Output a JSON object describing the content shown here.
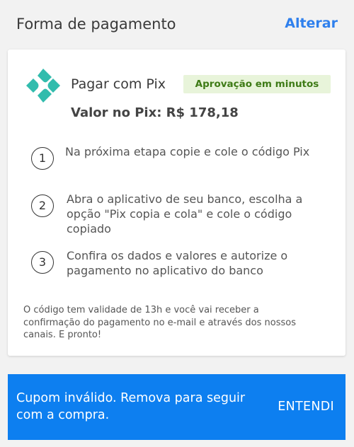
{
  "header": {
    "title": "Forma de pagamento",
    "action_label": "Alterar"
  },
  "payment": {
    "icon": "pix-logo-icon",
    "method_label": "Pagar com Pix",
    "badge": "Aprovação em minutos",
    "price": "Valor no Pix: R$ 178,18",
    "steps": [
      {
        "number": "1",
        "text": "Na próxima etapa copie e cole o código Pix"
      },
      {
        "number": "2",
        "text": "Abra o aplicativo de seu banco, escolha a opção \"Pix copia e cola\" e cole o código copiado"
      },
      {
        "number": "3",
        "text": "Confira os dados e valores e autorize o pagamento no aplicativo do banco"
      }
    ],
    "note": "O código tem validade de 13h e você vai receber a confirmação do pagamento no e-mail e através dos nossos canais. E pronto!"
  },
  "snackbar": {
    "message": "Cupom inválido. Remova para seguir com a compra.",
    "action_label": "ENTENDI"
  },
  "colors": {
    "accent": "#2f80ed",
    "pix": "#32bcad",
    "badge_bg": "#e8f4da",
    "badge_text": "#3e7b16",
    "snackbar_bg": "#0d7ff0"
  }
}
